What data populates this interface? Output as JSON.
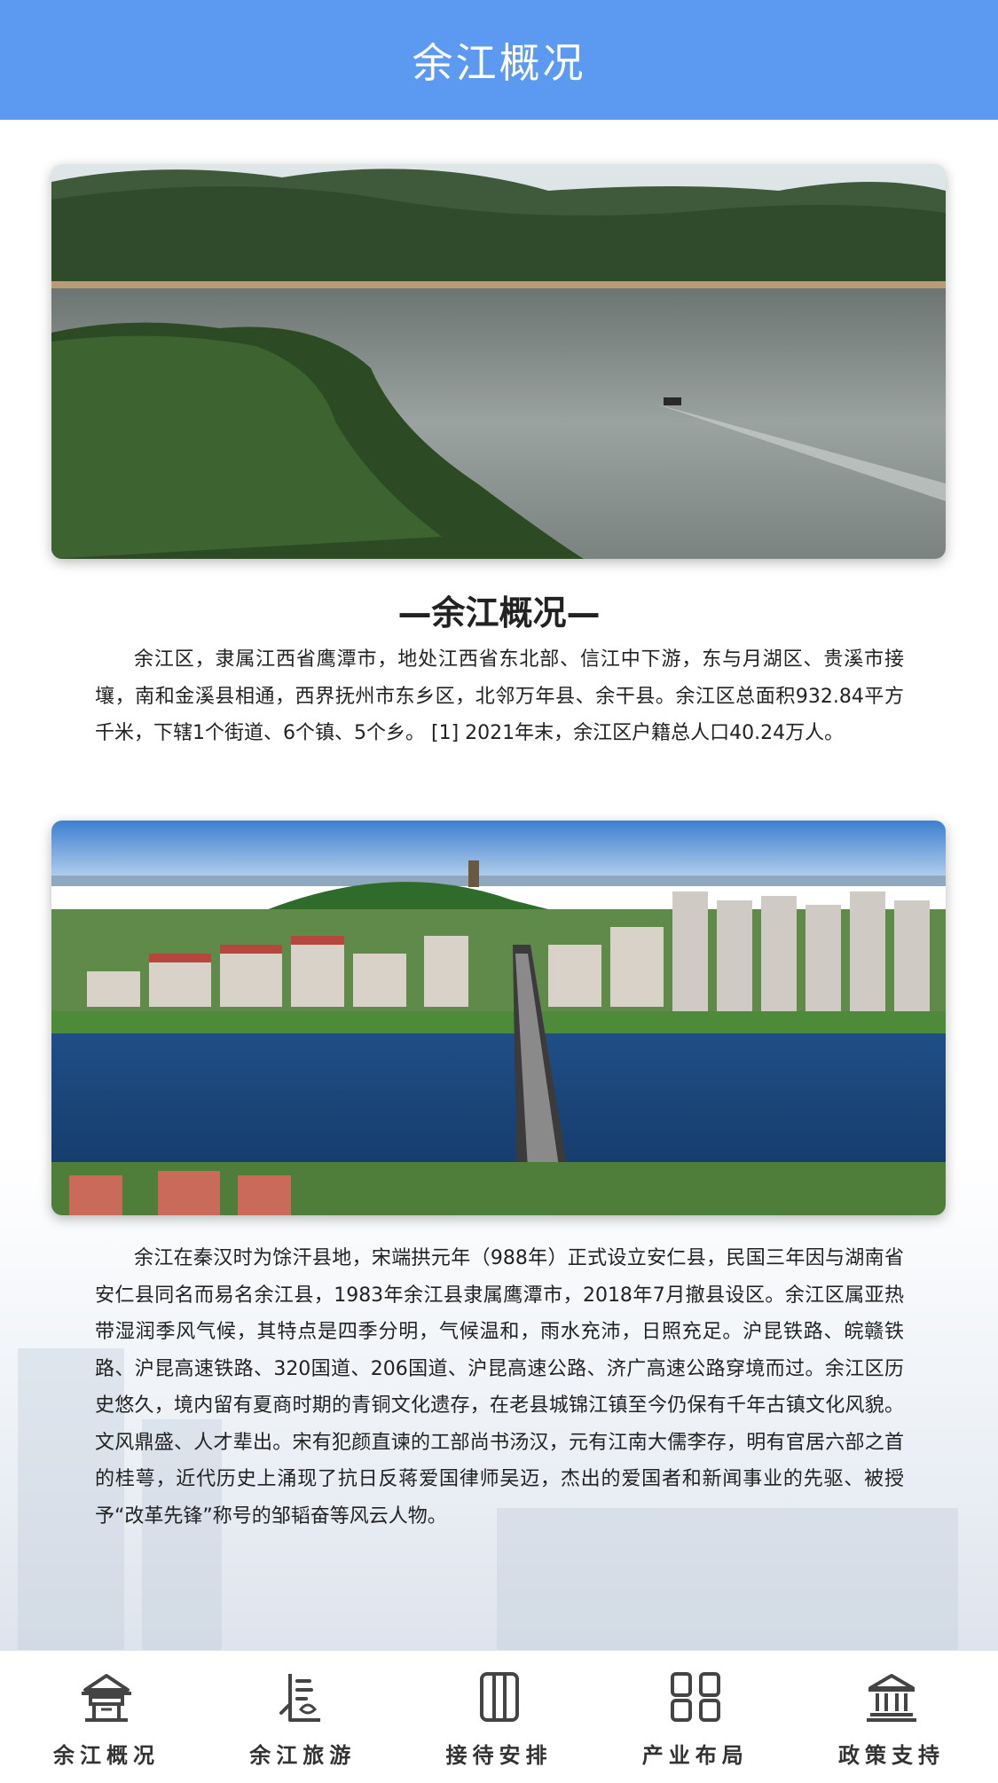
{
  "header": {
    "title": "余江概况"
  },
  "images": {
    "top": {
      "icon": "lake-mountain-photo"
    },
    "middle": {
      "icon": "city-bridge-photo"
    }
  },
  "section": {
    "title": "—余江概况—"
  },
  "intro": "余江区，隶属江西省鹰潭市，地处江西省东北部、信江中下游，东与月湖区、贵溪市接壤，南和金溪县相通，西界抚州市东乡区，北邻万年县、余干县。余江区总面积932.84平方千米，下辖1个街道、6个镇、5个乡。 [1] 2021年末，余江区户籍总人口40.24万人。",
  "history": "余江在秦汉时为馀汗县地，宋端拱元年（988年）正式设立安仁县，民国三年因与湖南省安仁县同名而易名余江县，1983年余江县隶属鹰潭市，2018年7月撤县设区。余江区属亚热带湿润季风气候，其特点是四季分明，气候温和，雨水充沛，日照充足。沪昆铁路、皖赣铁路、沪昆高速铁路、320国道、206国道、沪昆高速公路、济广高速公路穿境而过。余江区历史悠久，境内留有夏商时期的青铜文化遗存，在老县城锦江镇至今仍保有千年古镇文化风貌。文风鼎盛、人才辈出。宋有犯颜直谏的工部尚书汤汉，元有江南大儒李存，明有官居六部之首的桂萼，近代历史上涌现了抗日反蒋爱国律师吴迈，杰出的爱国者和新闻事业的先驱、被授予“改革先锋”称号的邹韬奋等风云人物。",
  "tabbar": {
    "tabs": [
      {
        "label": "余江概况",
        "icon": "pavilion-icon"
      },
      {
        "label": "余江旅游",
        "icon": "tourism-icon"
      },
      {
        "label": "接待安排",
        "icon": "reception-icon"
      },
      {
        "label": "产业布局",
        "icon": "grid-icon"
      },
      {
        "label": "政策支持",
        "icon": "government-icon"
      }
    ]
  },
  "colors": {
    "header": "#5b9af0",
    "text": "#222222"
  }
}
